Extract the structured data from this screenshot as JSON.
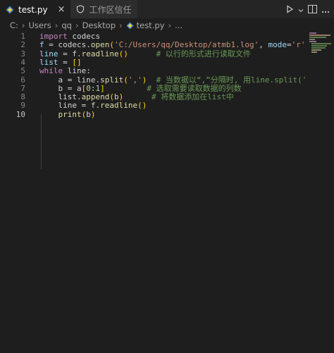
{
  "tabs": [
    {
      "label": "test.py",
      "close": "×"
    },
    {
      "label": "工作区信任"
    }
  ],
  "breadcrumb": [
    "C:",
    "Users",
    "qq",
    "Desktop",
    "test.py",
    "..."
  ],
  "breadcrumb_sep": "›",
  "lines": [
    {
      "n": "1",
      "tokens": [
        [
          "kw",
          "import"
        ],
        [
          "plain",
          " codecs"
        ]
      ]
    },
    {
      "n": "2",
      "tokens": [
        [
          "var",
          "f"
        ],
        [
          "plain",
          " = codecs."
        ],
        [
          "fn",
          "open"
        ],
        [
          "brk",
          "("
        ],
        [
          "str",
          "'C:/Users/qq/Desktop/atmb1.log'"
        ],
        [
          "plain",
          ", "
        ],
        [
          "var",
          "mode"
        ],
        [
          "plain",
          "="
        ],
        [
          "str",
          "'r'"
        ],
        [
          "plain",
          ", enc"
        ]
      ]
    },
    {
      "n": "3",
      "tokens": [
        [
          "var",
          "line"
        ],
        [
          "plain",
          " = f."
        ],
        [
          "fn",
          "readline"
        ],
        [
          "brk",
          "()"
        ],
        [
          "plain",
          "      "
        ],
        [
          "cm",
          "# 以行的形式进行读取文件"
        ]
      ]
    },
    {
      "n": "4",
      "tokens": [
        [
          "var",
          "list"
        ],
        [
          "plain",
          " = "
        ],
        [
          "brk",
          "[]"
        ]
      ]
    },
    {
      "n": "5",
      "tokens": [
        [
          "kw",
          "while"
        ],
        [
          "plain",
          " line:"
        ]
      ]
    },
    {
      "n": "6",
      "tokens": [
        [
          "plain",
          "    a = line."
        ],
        [
          "fn",
          "split"
        ],
        [
          "brk",
          "("
        ],
        [
          "str",
          "','"
        ],
        [
          "brk",
          ")"
        ],
        [
          "plain",
          "  "
        ],
        [
          "cm",
          "# 当数据以“,”分隔时, 用line.split(','"
        ]
      ]
    },
    {
      "n": "7",
      "tokens": [
        [
          "plain",
          "    b = a"
        ],
        [
          "brk",
          "["
        ],
        [
          "num",
          "0"
        ],
        [
          "plain",
          ":"
        ],
        [
          "num",
          "1"
        ],
        [
          "brk",
          "]"
        ],
        [
          "plain",
          "         "
        ],
        [
          "cm",
          "# 选取需要读取数据的列数"
        ]
      ]
    },
    {
      "n": "8",
      "tokens": [
        [
          "plain",
          "    list."
        ],
        [
          "fn",
          "append"
        ],
        [
          "brk",
          "("
        ],
        [
          "plain",
          "b"
        ],
        [
          "brk",
          ")"
        ],
        [
          "plain",
          "      "
        ],
        [
          "cm",
          "# 将数据添加在list中"
        ]
      ]
    },
    {
      "n": "9",
      "tokens": [
        [
          "plain",
          "    line = f."
        ],
        [
          "fn",
          "readline"
        ],
        [
          "brk",
          "()"
        ]
      ]
    },
    {
      "n": "10",
      "tokens": [
        [
          "plain",
          "    "
        ],
        [
          "fn",
          "print"
        ],
        [
          "brk",
          "("
        ],
        [
          "plain",
          "b"
        ],
        [
          "brk",
          ")"
        ]
      ]
    }
  ],
  "current_line": "10",
  "colors": {
    "background": "#1e1e1e",
    "tabbar": "#252526",
    "keyword": "#c586c0",
    "string": "#ce9178",
    "comment": "#6a9955",
    "function": "#dcdcaa"
  }
}
